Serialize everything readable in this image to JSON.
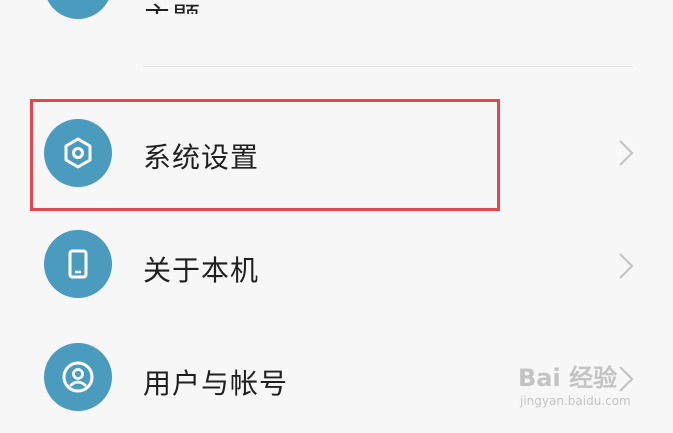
{
  "colors": {
    "background": "#f7f7f7",
    "icon_circle": "#4a9bbd",
    "highlight_border": "#e04a4e",
    "label_text": "#1f1f1f",
    "chevron": "#c4c4c4"
  },
  "top_partial_item": {
    "icon": "app-icon",
    "label": "主题"
  },
  "menu_items": [
    {
      "label": "系统设置",
      "icon": "settings-hexagon-icon",
      "highlighted": true
    },
    {
      "label": "关于本机",
      "icon": "phone-icon",
      "highlighted": false
    },
    {
      "label": "用户与帐号",
      "icon": "user-account-icon",
      "highlighted": false
    }
  ],
  "watermark": {
    "logo": "Bai 经验",
    "url": "jingyan.baidu.com"
  }
}
